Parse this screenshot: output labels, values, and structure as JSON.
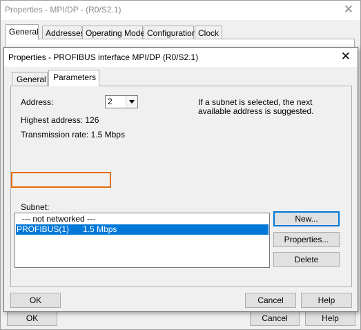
{
  "background_dialog": {
    "title": "Properties - MPI/DP  - (R0/S2.1)",
    "tabs": [
      "General",
      "Addresses",
      "Operating Mode",
      "Configuration",
      "Clock"
    ],
    "ok_label": "OK",
    "cancel_label": "Cancel",
    "help_label": "Help"
  },
  "dialog": {
    "title": "Properties - PROFIBUS interface  MPI/DP (R0/S2.1)",
    "tabs": [
      "General",
      "Parameters"
    ],
    "active_tab": "Parameters",
    "address_label": "Address:",
    "address_value": "2",
    "highest_address": "Highest address:  126",
    "transmission_rate": "Transmission rate:  1.5 Mbps",
    "info_line1": "If a subnet is selected, the next",
    "info_line2": "available address is suggested.",
    "subnet_label": "Subnet:",
    "subnet_items": [
      {
        "label": "--- not networked ---",
        "selected": false
      },
      {
        "label": "PROFIBUS(1)      1.5 Mbps",
        "selected": true
      }
    ],
    "buttons": {
      "new": "New...",
      "properties": "Properties...",
      "delete": "Delete",
      "ok": "OK",
      "cancel": "Cancel",
      "help": "Help"
    }
  },
  "colors": {
    "selection": "#0078d7",
    "highlight_outline": "#e46c0a"
  }
}
